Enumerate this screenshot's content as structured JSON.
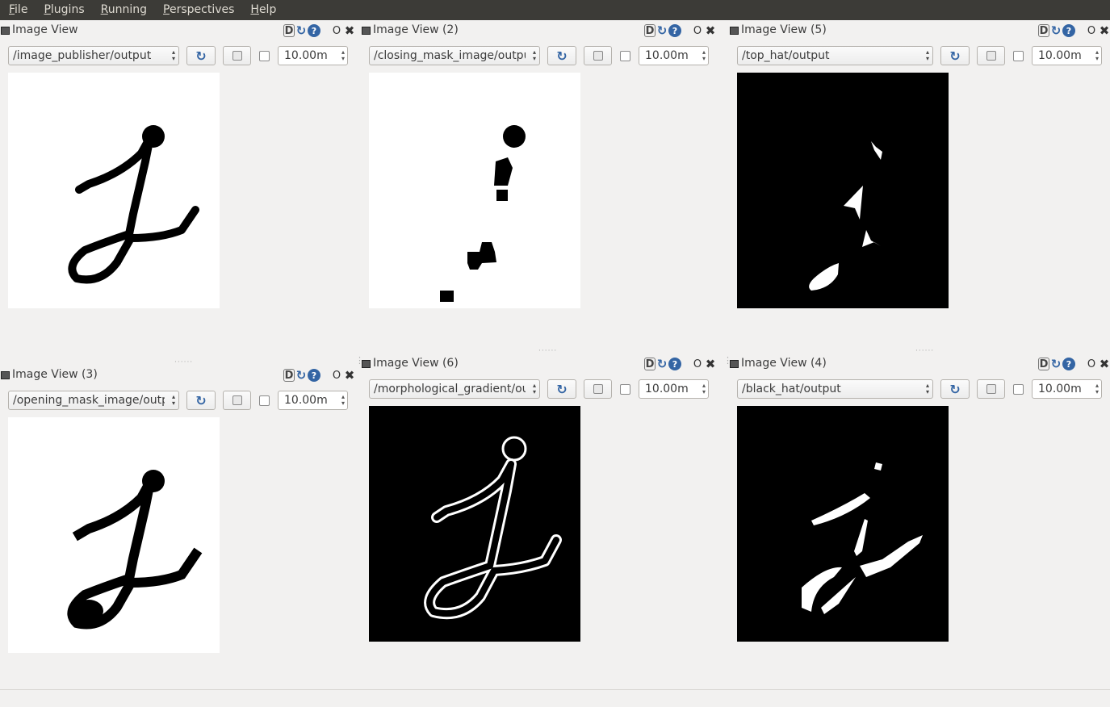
{
  "menu": [
    "File",
    "Plugins",
    "Running",
    "Perspectives",
    "Help"
  ],
  "panels": [
    {
      "title": "Image View",
      "topic": "/image_publisher/output",
      "value": "10.00m",
      "image": "original",
      "bg": "#ffffff",
      "ink": "#000000"
    },
    {
      "title": "Image View (2)",
      "topic": "/closing_mask_image/output",
      "value": "10.00m",
      "image": "closing",
      "bg": "#ffffff",
      "ink": "#000000"
    },
    {
      "title": "Image View (5)",
      "topic": "/top_hat/output",
      "value": "10.00m",
      "image": "top_hat",
      "bg": "#000000",
      "ink": "#ffffff"
    },
    {
      "title": "Image View (3)",
      "topic": "/opening_mask_image/outp",
      "value": "10.00m",
      "image": "opening",
      "bg": "#ffffff",
      "ink": "#000000"
    },
    {
      "title": "Image View (6)",
      "topic": "/morphological_gradient/outp",
      "value": "10.00m",
      "image": "gradient",
      "bg": "#000000",
      "ink": "#ffffff"
    },
    {
      "title": "Image View (4)",
      "topic": "/black_hat/output",
      "value": "10.00m",
      "image": "black_hat",
      "bg": "#000000",
      "ink": "#ffffff"
    }
  ],
  "title_icons": {
    "d": "D",
    "o": "O"
  }
}
